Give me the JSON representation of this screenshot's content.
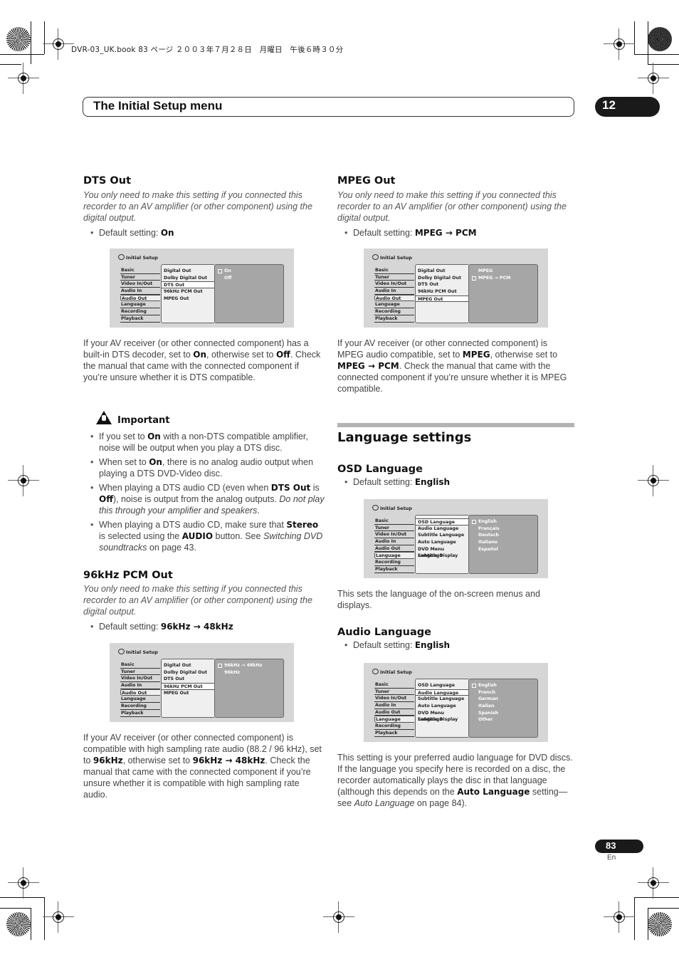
{
  "print_meta": "DVR-03_UK.book  83 ページ  ２００３年７月２８日　月曜日　午後６時３０分",
  "header": {
    "title": "The Initial Setup menu",
    "chapter": "12"
  },
  "footer": {
    "page": "83",
    "lang": "En"
  },
  "menu_common": {
    "title": "Initial Setup",
    "categories": [
      "Basic",
      "Tuner",
      "Video In/Out",
      "Audio In",
      "Audio Out",
      "Language",
      "Recording",
      "Playback"
    ],
    "audio_out_items": [
      "Digital Out",
      "Dolby Digital Out",
      "DTS Out",
      "96kHz PCM Out",
      "MPEG Out"
    ],
    "language_items": [
      "OSD Language",
      "Audio Language",
      "Subtitle Language",
      "Auto Language",
      "DVD Menu Language",
      "Subtitle Display"
    ]
  },
  "dts_out": {
    "heading": "DTS Out",
    "intro": "You only need to make this setting if you connected this recorder to an AV amplifier (or other component) using the digital output.",
    "default_label": "Default setting: ",
    "default_value": "On",
    "screen": {
      "selected_category": "Audio Out",
      "selected_item": "DTS Out",
      "options": [
        "On",
        "Off"
      ],
      "selected_option": "On"
    },
    "body_parts": [
      "If your AV receiver (or other connected component) has a built-in DTS decoder, set to ",
      "On",
      ", otherwise set to ",
      "Off",
      ". Check the manual that came with the connected component if you’re unsure whether it is DTS compatible."
    ]
  },
  "important": {
    "heading": "Important",
    "bullets": [
      [
        "If you set to ",
        "On",
        " with a non-DTS compatible amplifier, noise will be output when you play a DTS disc."
      ],
      [
        "When set to ",
        "On",
        ", there is no analog audio output when playing a DTS DVD-Video disc."
      ],
      [
        "When playing a DTS audio CD (even when ",
        "DTS Out",
        " is ",
        "Off",
        "), noise is output from the analog outputs. ",
        "Do not play this through your amplifier and speakers",
        "."
      ],
      [
        "When playing a DTS audio CD, make sure that ",
        "Stereo",
        " is selected using the ",
        "AUDIO",
        " button. See ",
        "Switching DVD soundtracks",
        " on page 43."
      ]
    ]
  },
  "pcm_out": {
    "heading": "96kHz PCM Out",
    "intro": "You only need to make this setting if you connected this recorder to an AV amplifier (or other component) using the digital output.",
    "default_label": "Default setting: ",
    "default_value": "96kHz → 48kHz",
    "screen": {
      "selected_category": "Audio Out",
      "selected_item": "96kHz PCM Out",
      "options": [
        "96kHz → 48kHz",
        "96kHz"
      ],
      "selected_option": "96kHz → 48kHz"
    },
    "body_parts": [
      "If your AV receiver (or other connected component) is compatible with high sampling rate audio (88.2 / 96 kHz), set to ",
      "96kHz",
      ", otherwise set to ",
      "96kHz → 48kHz",
      ". Check the manual that came with the connected component if you’re unsure whether it is compatible with high sampling rate audio."
    ]
  },
  "mpeg_out": {
    "heading": "MPEG Out",
    "intro": "You only need to make this setting if you connected this recorder to an AV amplifier (or other component) using the digital output.",
    "default_label": "Default setting: ",
    "default_value": "MPEG → PCM",
    "screen": {
      "selected_category": "Audio Out",
      "selected_item": "MPEG Out",
      "options": [
        "MPEG",
        "MPEG → PCM"
      ],
      "selected_option": "MPEG → PCM"
    },
    "body_parts": [
      "If your AV receiver (or other connected component) is MPEG audio compatible, set to ",
      "MPEG",
      ", otherwise set to ",
      "MPEG → PCM",
      ". Check the manual that came with the connected component if you’re unsure whether it is MPEG compatible."
    ]
  },
  "language_settings": {
    "heading": "Language settings"
  },
  "osd_language": {
    "heading": "OSD Language",
    "default_label": "Default setting: ",
    "default_value": "English",
    "screen": {
      "selected_category": "Language",
      "selected_item": "OSD Language",
      "options": [
        "English",
        "Français",
        "Deutsch",
        "Italiano",
        "Español"
      ],
      "selected_option": "English"
    },
    "body": "This sets the language of the on-screen menus and displays."
  },
  "audio_language": {
    "heading": "Audio Language",
    "default_label": "Default setting: ",
    "default_value": "English",
    "screen": {
      "selected_category": "Language",
      "selected_item": "Audio Language",
      "options": [
        "English",
        "French",
        "German",
        "Italian",
        "Spanish",
        "Other"
      ],
      "selected_option": "English"
    },
    "body_parts": [
      "This setting is your preferred audio language for DVD discs. If the language you specify here is recorded on a disc, the recorder automatically plays the disc in that language (although this depends on the ",
      "Auto Language",
      " setting—see ",
      "Auto Language",
      " on page 84)."
    ]
  }
}
